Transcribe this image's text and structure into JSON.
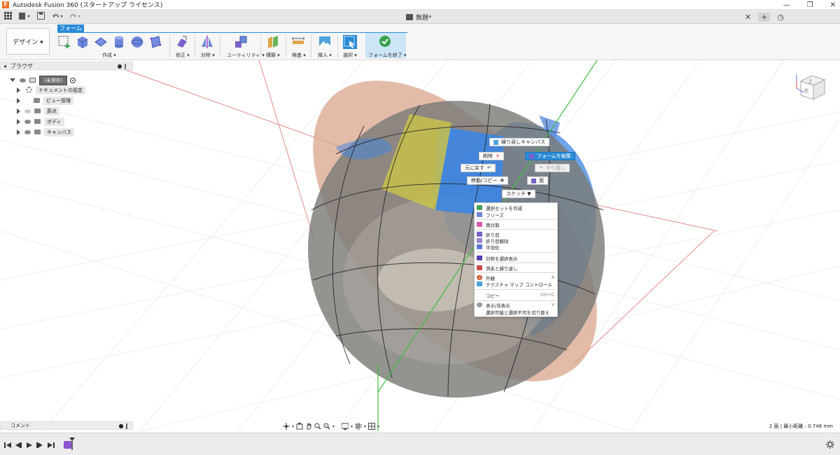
{
  "window": {
    "title": "Autodesk Fusion 360 (スタートアップ ライセンス)",
    "logo_letter": "F",
    "controls": [
      "—",
      "❐",
      "✕"
    ]
  },
  "quickbar": {
    "document_title": "無題*",
    "tab_close": "✕",
    "tab_add": "+",
    "tab_clock": "◷"
  },
  "ribbon": {
    "workspace": "デザイン ▾",
    "active_tab": "フォーム",
    "groups": [
      "作成 ▾",
      "修正 ▾",
      "対称 ▾",
      "ユーティリティ ▾",
      "構築 ▾",
      "検査 ▾",
      "挿入 ▾",
      "選択 ▾",
      "フォームを終了 ▾"
    ]
  },
  "browser": {
    "title": "ブラウザ",
    "items": [
      {
        "label": "(未保存)"
      },
      {
        "label": "ドキュメントの設定"
      },
      {
        "label": "ビュー管理"
      },
      {
        "label": "原点"
      },
      {
        "label": "ボディ"
      },
      {
        "label": "キャンバス"
      }
    ]
  },
  "comments": {
    "title": "コメント"
  },
  "marking_menu": {
    "repeat": "繰り返しキャンバス",
    "delete": "削除",
    "edit_form": "フォームを編集",
    "undo": "元に戻す",
    "redo": "やり直し",
    "move_copy": "移動/コピー",
    "face": "面",
    "sketch": "スケッチ ▼"
  },
  "context_menu": {
    "items": [
      {
        "label": "選択セットを作成",
        "shortcut": ""
      },
      {
        "label": "フリーズ",
        "shortcut": ""
      },
      {
        "label": "再分割",
        "shortcut": ""
      },
      {
        "label": "折り目",
        "shortcut": ""
      },
      {
        "label": "折り目解除",
        "shortcut": ""
      },
      {
        "label": "平坦化",
        "shortcut": ""
      },
      {
        "label": "対称を選択表示",
        "shortcut": ""
      },
      {
        "label": "滑走と繰り返し",
        "shortcut": ""
      },
      {
        "label": "外観",
        "shortcut": "A"
      },
      {
        "label": "テクスチャ マップ コントロール",
        "shortcut": ""
      },
      {
        "label": "コピー",
        "shortcut": "Ctrl+C"
      },
      {
        "label": "表示/非表示",
        "shortcut": "V"
      },
      {
        "label": "選択可能と選択不可を切り替え",
        "shortcut": ""
      }
    ]
  },
  "viewcube": {
    "top_label": "上",
    "front_label": "前"
  },
  "status": {
    "text": "2 面 | 最小距離 : 0.748 mm"
  },
  "colors": {
    "accent": "#2b8bd6",
    "ribbon_bg": "#f6f6f6",
    "selection_blue": "#3d86e3",
    "selection_yellow": "#c8c14a",
    "canvas_ellipse": "#d9a48c",
    "sphere": "#7b7b78"
  }
}
